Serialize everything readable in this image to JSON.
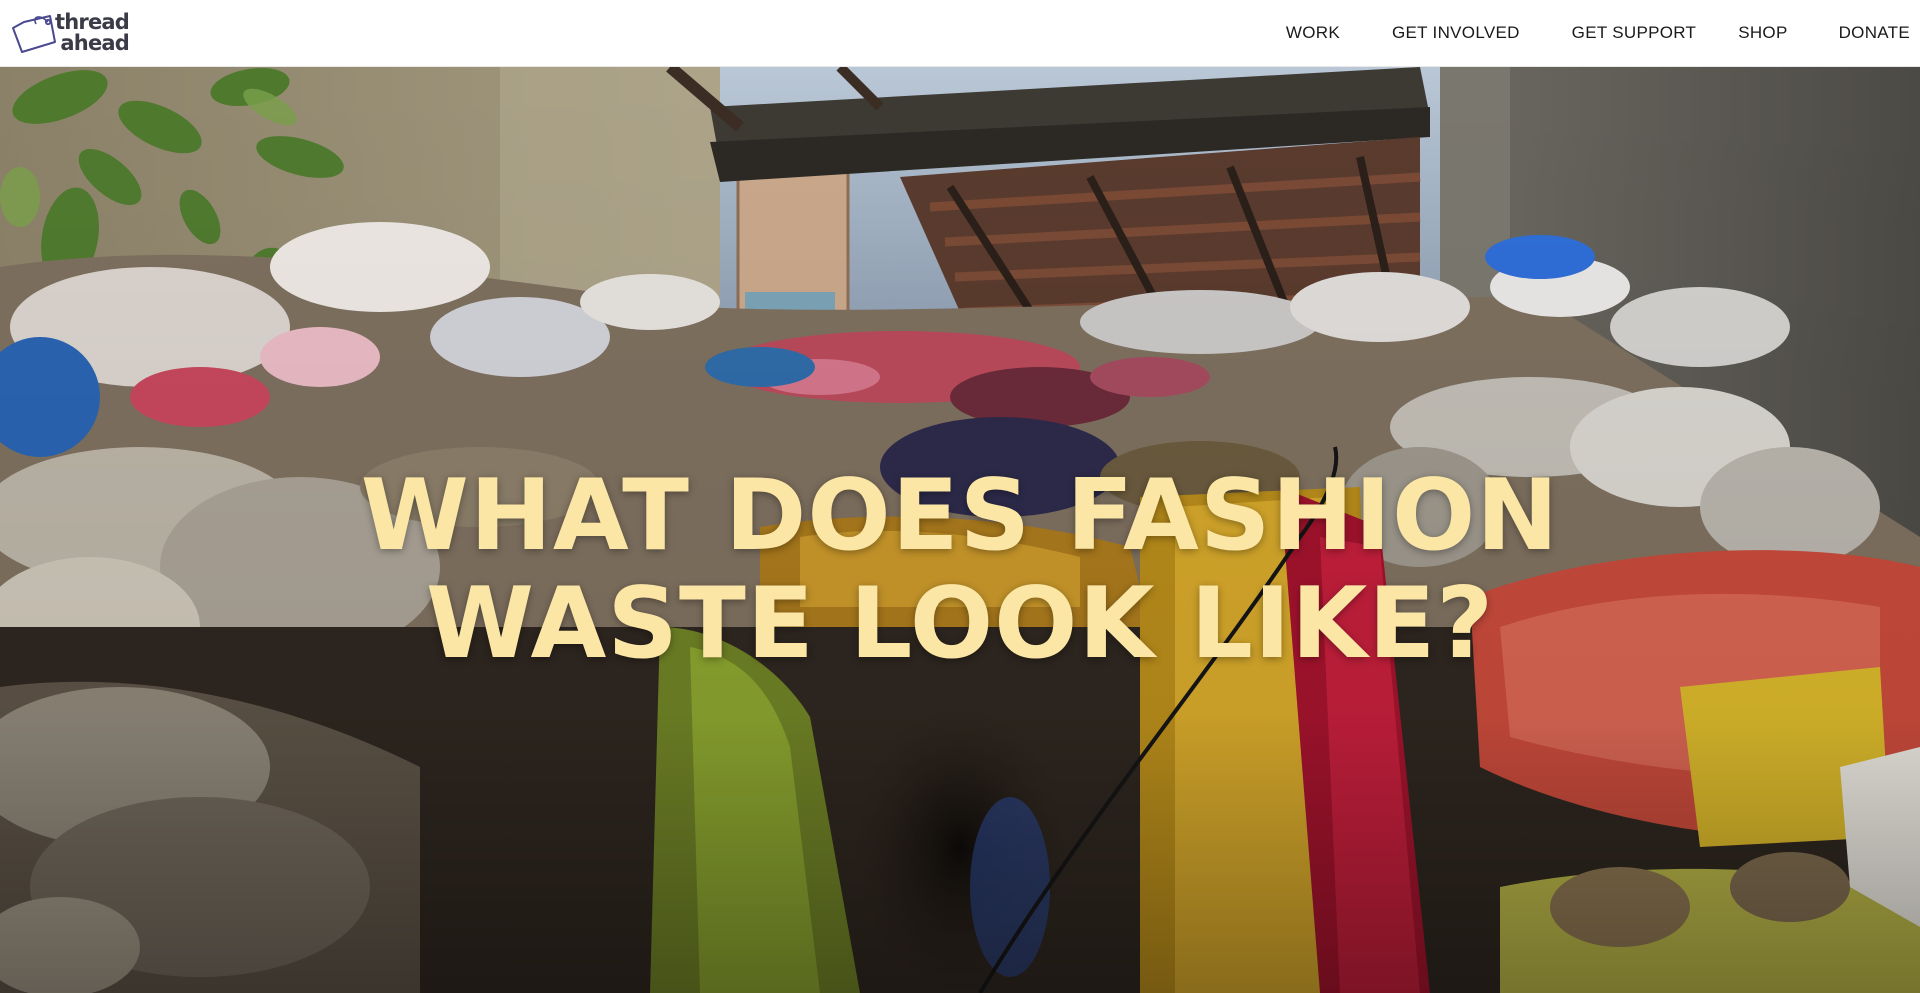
{
  "brand": {
    "line1": "thread",
    "line2": "ahead",
    "logo_color": "#3b3b48",
    "logo_icon": "tag-icon"
  },
  "nav": {
    "items": [
      {
        "label": "WORK"
      },
      {
        "label": "GET INVOLVED"
      },
      {
        "label": "GET SUPPORT"
      },
      {
        "label": "SHOP"
      },
      {
        "label": "DONATE"
      }
    ]
  },
  "hero": {
    "title_line1": "WHAT DOES FASHION",
    "title_line2": "WASTE LOOK LIKE?",
    "title_color": "#fbe6a6",
    "image": "photo of a pile of discarded clothing and plastic waste"
  }
}
